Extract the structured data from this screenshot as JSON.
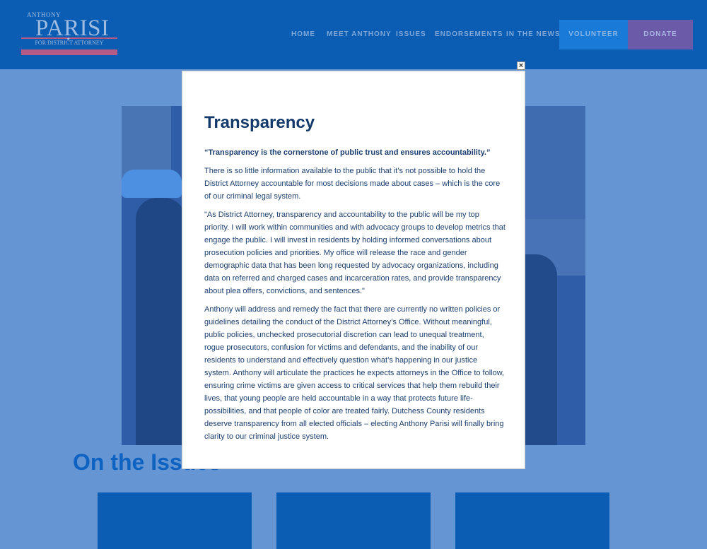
{
  "logo": {
    "small": "ANTHONY",
    "big": "PARISI",
    "sub": "FOR DISTRICT ATTORNEY"
  },
  "nav": {
    "items": [
      "HOME",
      "MEET ANTHONY",
      "ISSUES",
      "ENDORSEMENTS",
      "IN THE NEWS"
    ],
    "volunteer": "VOLUNTEER",
    "donate": "DONATE"
  },
  "page": {
    "issues_heading": "On the Issues"
  },
  "modal": {
    "close_icon": "close-icon",
    "title": "Transparency",
    "lead": "“Transparency is the cornerstone of public trust and ensures accountability.”",
    "p1": "There is so little information available to the public that it’s not possible to hold the District Attorney accountable for most decisions made about cases – which is the core of our criminal legal system.",
    "p2": "\"As District Attorney, transparency and accountability to the public will be my top priority. I will work within communities and with advocacy groups to develop metrics that engage the public.  I will invest in residents by holding informed conversations about prosecution policies and priorities.  My office will release the race and gender demographic data that has been long requested by advocacy organizations, including data on referred and charged cases and incarceration rates, and provide transparency about plea offers, convictions, and sentences.\"",
    "p3": "Anthony will address and remedy the fact that there are currently no written policies or guidelines detailing the conduct of the District Attorney’s Office. Without meaningful, public policies, unchecked prosecutorial discretion can lead to unequal treatment, rogue prosecutors, confusion for victims and defendants, and the inability of our residents to understand and effectively question what’s happening in our justice system. Anthony will articulate the practices he expects attorneys in the Office to follow, ensuring crime victims are given access to critical services that help them rebuild their lives, that young people are held accountable in a way that protects future life-possibilities, and that people of color are treated fairly. Dutchess County residents deserve transparency from all elected officials – electing Anthony Parisi will finally bring clarity to our criminal justice system."
  },
  "colors": {
    "header_bg": "#0b5db3",
    "overlay_bg": "#6596d3",
    "volunteer_bg": "#1a7ad8",
    "donate_bg": "#6b5aa8",
    "modal_title": "#143a6b"
  }
}
